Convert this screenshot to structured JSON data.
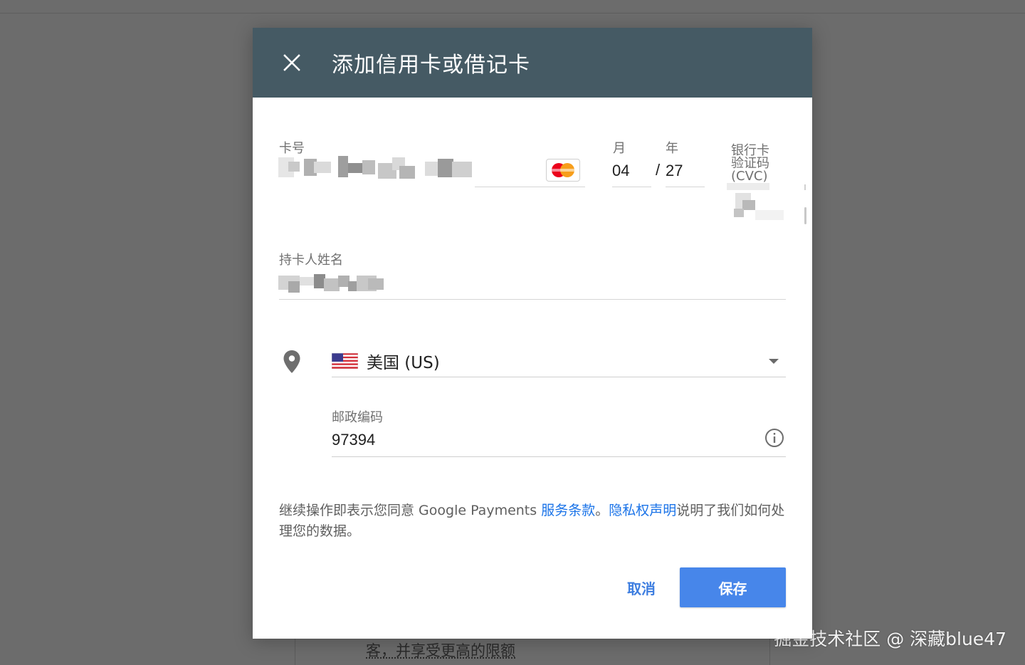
{
  "background": {
    "text": "客，并享受更高的限额",
    "watermark": "掘金技术社区 @ 深藏blue47"
  },
  "dialog": {
    "title": "添加信用卡或借记卡",
    "close_icon": "close-icon",
    "card_number": {
      "label": "卡号",
      "value_masked": true,
      "brand_icon": "mastercard-icon"
    },
    "expiry": {
      "month_label": "月",
      "year_label": "年",
      "month_value": "04",
      "separator": "/",
      "year_value": "27"
    },
    "cvc": {
      "label_line1": "银行卡",
      "label_line2": "验证码",
      "label_line3": "(CVC)",
      "value_masked": true
    },
    "cardholder": {
      "label": "持卡人姓名",
      "value_masked": true
    },
    "country": {
      "icon": "location-pin-icon",
      "flag_icon": "us-flag-icon",
      "value": "美国 (US)"
    },
    "postal": {
      "label": "邮政编码",
      "value": "97394",
      "info_icon": "info-icon"
    },
    "terms": {
      "prefix": "继续操作即表示您同意 Google Payments ",
      "tos_link": "服务条款",
      "mid": "。",
      "privacy_link": "隐私权声明",
      "suffix": "说明了我们如何处理您的数据。"
    },
    "actions": {
      "cancel": "取消",
      "save": "保存"
    }
  },
  "colors": {
    "header_bg": "#455a64",
    "primary": "#4786ea",
    "link": "#1a73e8",
    "overlay": "#6c6c6c"
  }
}
